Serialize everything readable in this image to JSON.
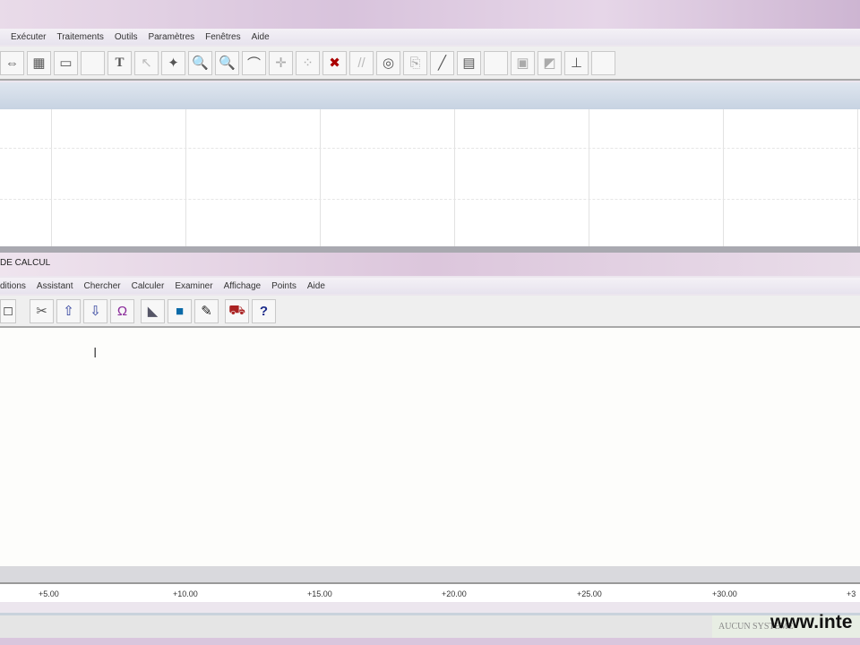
{
  "main_menu": [
    "Exécuter",
    "Traitements",
    "Outils",
    "Paramètres",
    "Fenêtres",
    "Aide"
  ],
  "main_toolbar": [
    "zoom-fit",
    "table",
    "sheet",
    "blank",
    "text",
    "pointer",
    "shape",
    "zoom-in",
    "zoom",
    "curve",
    "move",
    "points",
    "delete-points",
    "parallel",
    "target",
    "paste",
    "pen",
    "document",
    "blank2",
    "image",
    "edit-image",
    "plot"
  ],
  "panel_title": "DE CALCUL",
  "calc_menu": [
    "ditions",
    "Assistant",
    "Chercher",
    "Calculer",
    "Examiner",
    "Affichage",
    "Points",
    "Aide"
  ],
  "calc_toolbar": [
    "window",
    "cut",
    "select-up",
    "select-down",
    "omega",
    "chart",
    "fill",
    "brush",
    "car",
    "help"
  ],
  "ruler_labels": [
    "+5.00",
    "+10.00",
    "+15.00",
    "+20.00",
    "+25.00",
    "+30.00",
    "+3"
  ],
  "status_text": "AUCUN SYSTEME",
  "watermark": "www.inte"
}
